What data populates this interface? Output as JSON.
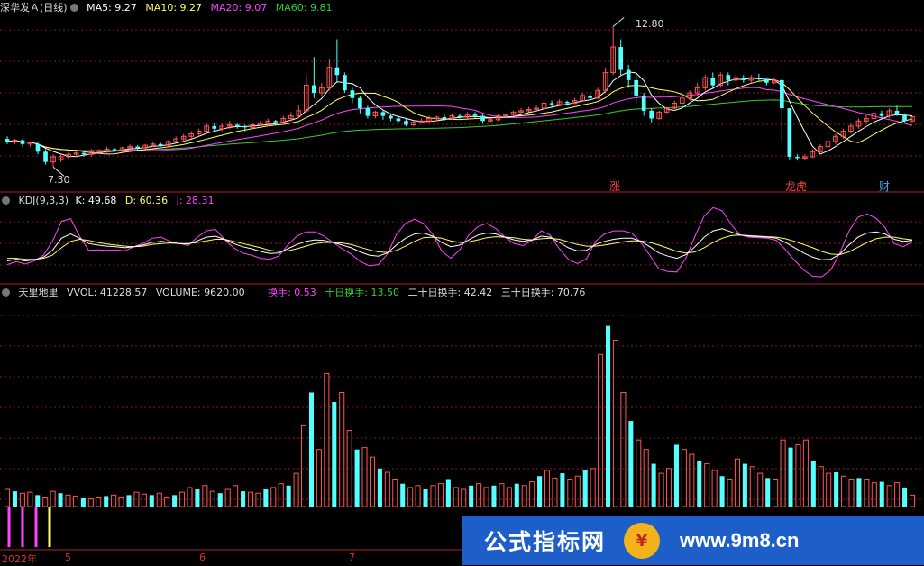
{
  "main": {
    "title": "深华发Ａ(日线)",
    "ma5": "MA5: 9.27",
    "ma10": "MA10: 9.27",
    "ma20": "MA20: 9.07",
    "ma60": "MA60: 9.81",
    "high_label": "12.80",
    "low_label": "7.30",
    "markers": [
      "涨",
      "龙虎",
      "财"
    ]
  },
  "kdj": {
    "name": "KDJ(9,3,3)",
    "k": "K: 49.68",
    "d": "D: 60.36",
    "j": "J: 28.31"
  },
  "vol": {
    "name": "天里地里",
    "vvol": "VVOL: 41228.57",
    "volume": "VOLUME: 9620.00",
    "turnover": "换手: 0.53",
    "turnover10": "十日换手: 13.50",
    "turnover20": "二十日换手: 42.42",
    "turnover30": "三十日换手: 70.76"
  },
  "axis": {
    "labels": [
      "2022年",
      "5",
      "6",
      "7"
    ]
  },
  "watermark": {
    "cn": "公式指标网",
    "url": "www.9m8.cn"
  },
  "colors": {
    "up": "#ff5555",
    "down": "#54ffff",
    "ma5": "#ffffff",
    "ma10": "#ffff66",
    "ma20": "#ff44ff",
    "ma60": "#33cc33",
    "grid": "#8a1a1a"
  },
  "chart_data": {
    "type": "candlestick",
    "price_range": [
      6.5,
      13.2
    ],
    "candles": [
      {
        "o": 8.4,
        "c": 8.3,
        "h": 8.5,
        "l": 8.2
      },
      {
        "o": 8.3,
        "c": 8.35,
        "h": 8.4,
        "l": 8.2
      },
      {
        "o": 8.35,
        "c": 8.2,
        "h": 8.4,
        "l": 8.1
      },
      {
        "o": 8.2,
        "c": 8.25,
        "h": 8.3,
        "l": 8.1
      },
      {
        "o": 8.2,
        "c": 7.9,
        "h": 8.3,
        "l": 7.8
      },
      {
        "o": 7.9,
        "c": 7.5,
        "h": 8.0,
        "l": 7.4
      },
      {
        "o": 7.5,
        "c": 7.7,
        "h": 7.8,
        "l": 7.3
      },
      {
        "o": 7.6,
        "c": 7.7,
        "h": 7.8,
        "l": 7.5
      },
      {
        "o": 7.7,
        "c": 7.8,
        "h": 7.9,
        "l": 7.6
      },
      {
        "o": 7.8,
        "c": 7.85,
        "h": 7.9,
        "l": 7.7
      },
      {
        "o": 7.85,
        "c": 7.8,
        "h": 7.95,
        "l": 7.7
      },
      {
        "o": 7.8,
        "c": 7.9,
        "h": 8.0,
        "l": 7.7
      },
      {
        "o": 7.9,
        "c": 7.95,
        "h": 8.0,
        "l": 7.8
      },
      {
        "o": 7.95,
        "c": 8.0,
        "h": 8.1,
        "l": 7.85
      },
      {
        "o": 8.0,
        "c": 7.95,
        "h": 8.05,
        "l": 7.9
      },
      {
        "o": 7.95,
        "c": 8.05,
        "h": 8.1,
        "l": 7.9
      },
      {
        "o": 8.05,
        "c": 8.1,
        "h": 8.2,
        "l": 8.0
      },
      {
        "o": 8.1,
        "c": 8.05,
        "h": 8.15,
        "l": 7.95
      },
      {
        "o": 8.05,
        "c": 8.15,
        "h": 8.2,
        "l": 8.0
      },
      {
        "o": 8.15,
        "c": 8.2,
        "h": 8.3,
        "l": 8.1
      },
      {
        "o": 8.2,
        "c": 8.15,
        "h": 8.25,
        "l": 8.1
      },
      {
        "o": 8.15,
        "c": 8.3,
        "h": 8.35,
        "l": 8.1
      },
      {
        "o": 8.3,
        "c": 8.4,
        "h": 8.5,
        "l": 8.25
      },
      {
        "o": 8.4,
        "c": 8.5,
        "h": 8.6,
        "l": 8.3
      },
      {
        "o": 8.5,
        "c": 8.6,
        "h": 8.7,
        "l": 8.4
      },
      {
        "o": 8.6,
        "c": 8.7,
        "h": 8.8,
        "l": 8.5
      },
      {
        "o": 8.7,
        "c": 8.9,
        "h": 9.0,
        "l": 8.6
      },
      {
        "o": 8.9,
        "c": 8.8,
        "h": 9.0,
        "l": 8.7
      },
      {
        "o": 8.8,
        "c": 8.9,
        "h": 9.0,
        "l": 8.7
      },
      {
        "o": 8.9,
        "c": 8.95,
        "h": 9.1,
        "l": 8.8
      },
      {
        "o": 8.95,
        "c": 8.9,
        "h": 9.0,
        "l": 8.8
      },
      {
        "o": 8.9,
        "c": 8.85,
        "h": 8.95,
        "l": 8.7
      },
      {
        "o": 8.85,
        "c": 8.95,
        "h": 9.0,
        "l": 8.8
      },
      {
        "o": 8.95,
        "c": 9.0,
        "h": 9.1,
        "l": 8.9
      },
      {
        "o": 9.0,
        "c": 9.1,
        "h": 9.2,
        "l": 8.9
      },
      {
        "o": 9.1,
        "c": 9.05,
        "h": 9.15,
        "l": 8.95
      },
      {
        "o": 9.05,
        "c": 9.2,
        "h": 9.3,
        "l": 9.0
      },
      {
        "o": 9.2,
        "c": 9.3,
        "h": 9.45,
        "l": 9.1
      },
      {
        "o": 9.3,
        "c": 9.5,
        "h": 9.7,
        "l": 9.2
      },
      {
        "o": 9.5,
        "c": 10.5,
        "h": 10.9,
        "l": 9.4
      },
      {
        "o": 10.5,
        "c": 10.2,
        "h": 11.6,
        "l": 10.0
      },
      {
        "o": 10.2,
        "c": 10.4,
        "h": 10.6,
        "l": 10.1
      },
      {
        "o": 10.4,
        "c": 11.2,
        "h": 11.5,
        "l": 10.3
      },
      {
        "o": 11.2,
        "c": 10.9,
        "h": 12.3,
        "l": 10.6
      },
      {
        "o": 10.9,
        "c": 10.3,
        "h": 11.0,
        "l": 10.2
      },
      {
        "o": 10.3,
        "c": 10.0,
        "h": 10.4,
        "l": 9.8
      },
      {
        "o": 10.0,
        "c": 9.6,
        "h": 10.1,
        "l": 9.4
      },
      {
        "o": 9.6,
        "c": 9.3,
        "h": 9.7,
        "l": 9.2
      },
      {
        "o": 9.3,
        "c": 9.45,
        "h": 9.5,
        "l": 9.2
      },
      {
        "o": 9.45,
        "c": 9.3,
        "h": 9.5,
        "l": 9.15
      },
      {
        "o": 9.3,
        "c": 9.2,
        "h": 9.4,
        "l": 9.1
      },
      {
        "o": 9.2,
        "c": 9.1,
        "h": 9.3,
        "l": 9.0
      },
      {
        "o": 9.1,
        "c": 8.95,
        "h": 9.2,
        "l": 8.9
      },
      {
        "o": 8.95,
        "c": 9.05,
        "h": 9.1,
        "l": 8.9
      },
      {
        "o": 9.05,
        "c": 9.1,
        "h": 9.2,
        "l": 9.0
      },
      {
        "o": 9.1,
        "c": 9.2,
        "h": 9.3,
        "l": 9.05
      },
      {
        "o": 9.2,
        "c": 9.25,
        "h": 9.3,
        "l": 9.1
      },
      {
        "o": 9.25,
        "c": 9.2,
        "h": 9.35,
        "l": 9.1
      },
      {
        "o": 9.2,
        "c": 9.3,
        "h": 9.4,
        "l": 9.15
      },
      {
        "o": 9.3,
        "c": 9.25,
        "h": 9.4,
        "l": 9.2
      },
      {
        "o": 9.25,
        "c": 9.35,
        "h": 9.45,
        "l": 9.2
      },
      {
        "o": 9.35,
        "c": 9.3,
        "h": 9.45,
        "l": 9.2
      },
      {
        "o": 9.3,
        "c": 9.1,
        "h": 9.35,
        "l": 9.0
      },
      {
        "o": 9.1,
        "c": 9.15,
        "h": 9.2,
        "l": 9.05
      },
      {
        "o": 9.15,
        "c": 9.3,
        "h": 9.35,
        "l": 9.1
      },
      {
        "o": 9.3,
        "c": 9.35,
        "h": 9.4,
        "l": 9.25
      },
      {
        "o": 9.35,
        "c": 9.45,
        "h": 9.5,
        "l": 9.3
      },
      {
        "o": 9.45,
        "c": 9.5,
        "h": 9.6,
        "l": 9.4
      },
      {
        "o": 9.5,
        "c": 9.55,
        "h": 9.65,
        "l": 9.45
      },
      {
        "o": 9.55,
        "c": 9.6,
        "h": 9.7,
        "l": 9.5
      },
      {
        "o": 9.6,
        "c": 9.8,
        "h": 9.9,
        "l": 9.55
      },
      {
        "o": 9.8,
        "c": 9.75,
        "h": 9.9,
        "l": 9.65
      },
      {
        "o": 9.75,
        "c": 9.85,
        "h": 9.95,
        "l": 9.7
      },
      {
        "o": 9.85,
        "c": 9.8,
        "h": 9.9,
        "l": 9.7
      },
      {
        "o": 9.8,
        "c": 9.9,
        "h": 10.0,
        "l": 9.75
      },
      {
        "o": 9.9,
        "c": 10.1,
        "h": 10.2,
        "l": 9.85
      },
      {
        "o": 10.1,
        "c": 10.0,
        "h": 10.2,
        "l": 9.9
      },
      {
        "o": 10.0,
        "c": 10.3,
        "h": 10.4,
        "l": 9.95
      },
      {
        "o": 10.3,
        "c": 11.0,
        "h": 11.2,
        "l": 10.2
      },
      {
        "o": 11.0,
        "c": 12.0,
        "h": 12.8,
        "l": 10.9
      },
      {
        "o": 12.0,
        "c": 11.1,
        "h": 12.3,
        "l": 10.9
      },
      {
        "o": 11.1,
        "c": 10.7,
        "h": 11.3,
        "l": 10.4
      },
      {
        "o": 10.7,
        "c": 10.1,
        "h": 10.9,
        "l": 9.8
      },
      {
        "o": 10.1,
        "c": 9.5,
        "h": 10.2,
        "l": 9.3
      },
      {
        "o": 9.5,
        "c": 9.2,
        "h": 9.6,
        "l": 9.05
      },
      {
        "o": 9.2,
        "c": 9.45,
        "h": 9.5,
        "l": 9.15
      },
      {
        "o": 9.45,
        "c": 9.6,
        "h": 9.65,
        "l": 9.4
      },
      {
        "o": 9.6,
        "c": 9.8,
        "h": 9.9,
        "l": 9.5
      },
      {
        "o": 9.8,
        "c": 10.0,
        "h": 10.1,
        "l": 9.7
      },
      {
        "o": 10.0,
        "c": 10.2,
        "h": 10.3,
        "l": 9.9
      },
      {
        "o": 10.2,
        "c": 10.4,
        "h": 10.6,
        "l": 10.1
      },
      {
        "o": 10.4,
        "c": 10.8,
        "h": 10.9,
        "l": 10.3
      },
      {
        "o": 10.8,
        "c": 10.5,
        "h": 11.0,
        "l": 10.4
      },
      {
        "o": 10.5,
        "c": 10.9,
        "h": 11.0,
        "l": 10.4
      },
      {
        "o": 10.9,
        "c": 10.7,
        "h": 11.0,
        "l": 10.5
      },
      {
        "o": 10.7,
        "c": 10.8,
        "h": 10.9,
        "l": 10.6
      },
      {
        "o": 10.8,
        "c": 10.7,
        "h": 10.9,
        "l": 10.6
      },
      {
        "o": 10.7,
        "c": 10.8,
        "h": 10.9,
        "l": 10.6
      },
      {
        "o": 10.8,
        "c": 10.75,
        "h": 10.95,
        "l": 10.65
      },
      {
        "o": 10.75,
        "c": 10.6,
        "h": 10.8,
        "l": 10.5
      },
      {
        "o": 10.6,
        "c": 10.7,
        "h": 10.8,
        "l": 10.55
      },
      {
        "o": 10.7,
        "c": 9.6,
        "h": 10.8,
        "l": 8.3
      },
      {
        "o": 9.6,
        "c": 7.7,
        "h": 9.6,
        "l": 7.6
      },
      {
        "o": 7.7,
        "c": 7.65,
        "h": 7.8,
        "l": 7.55
      },
      {
        "o": 7.65,
        "c": 7.7,
        "h": 7.8,
        "l": 7.6
      },
      {
        "o": 7.7,
        "c": 7.9,
        "h": 8.0,
        "l": 7.65
      },
      {
        "o": 7.9,
        "c": 8.1,
        "h": 8.2,
        "l": 7.85
      },
      {
        "o": 8.1,
        "c": 8.3,
        "h": 8.4,
        "l": 8.0
      },
      {
        "o": 8.3,
        "c": 8.5,
        "h": 8.6,
        "l": 8.2
      },
      {
        "o": 8.5,
        "c": 8.7,
        "h": 8.8,
        "l": 8.4
      },
      {
        "o": 8.7,
        "c": 8.9,
        "h": 9.0,
        "l": 8.6
      },
      {
        "o": 8.9,
        "c": 9.1,
        "h": 9.2,
        "l": 8.8
      },
      {
        "o": 9.1,
        "c": 9.2,
        "h": 9.4,
        "l": 9.0
      },
      {
        "o": 9.2,
        "c": 9.4,
        "h": 9.5,
        "l": 9.1
      },
      {
        "o": 9.4,
        "c": 9.3,
        "h": 9.5,
        "l": 9.2
      },
      {
        "o": 9.3,
        "c": 9.5,
        "h": 9.6,
        "l": 9.2
      },
      {
        "o": 9.5,
        "c": 9.35,
        "h": 9.7,
        "l": 9.3
      },
      {
        "o": 9.35,
        "c": 9.1,
        "h": 9.4,
        "l": 9.05
      },
      {
        "o": 9.1,
        "c": 9.27,
        "h": 9.3,
        "l": 9.05
      }
    ],
    "kdj": {
      "k": [
        15,
        18,
        15,
        17,
        22,
        35,
        58,
        66,
        58,
        48,
        45,
        43,
        42,
        40,
        42,
        45,
        50,
        52,
        50,
        48,
        47,
        53,
        60,
        62,
        56,
        48,
        42,
        38,
        33,
        29,
        30,
        38,
        46,
        52,
        55,
        54,
        50,
        45,
        40,
        32,
        26,
        24,
        30,
        45,
        58,
        66,
        68,
        62,
        50,
        42,
        45,
        55,
        64,
        68,
        66,
        60,
        55,
        52,
        55,
        62,
        60,
        50,
        40,
        34,
        35,
        46,
        52,
        56,
        58,
        58,
        52,
        42,
        30,
        24,
        20,
        27,
        42,
        60,
        72,
        76,
        70,
        64,
        62,
        61,
        60,
        58,
        50,
        40,
        30,
        22,
        17,
        18,
        28,
        45,
        60,
        68,
        70,
        66,
        56,
        52,
        54
      ],
      "d": [
        20,
        20,
        18,
        18,
        20,
        26,
        40,
        52,
        56,
        54,
        50,
        47,
        45,
        43,
        42,
        43,
        46,
        48,
        49,
        48,
        48,
        50,
        53,
        56,
        56,
        52,
        48,
        44,
        40,
        35,
        33,
        34,
        38,
        43,
        48,
        50,
        50,
        49,
        46,
        41,
        36,
        32,
        31,
        35,
        43,
        52,
        59,
        60,
        58,
        53,
        50,
        51,
        55,
        59,
        61,
        60,
        59,
        56,
        55,
        57,
        58,
        56,
        51,
        46,
        43,
        43,
        45,
        48,
        51,
        53,
        53,
        50,
        45,
        39,
        33,
        30,
        32,
        40,
        50,
        58,
        63,
        64,
        63,
        62,
        61,
        60,
        57,
        52,
        46,
        40,
        33,
        28,
        27,
        32,
        41,
        50,
        57,
        60,
        60,
        57,
        55
      ],
      "j": [
        8,
        14,
        9,
        15,
        26,
        52,
        90,
        95,
        62,
        35,
        36,
        35,
        36,
        34,
        42,
        48,
        58,
        60,
        52,
        48,
        44,
        60,
        72,
        75,
        56,
        40,
        30,
        26,
        20,
        18,
        24,
        45,
        62,
        70,
        70,
        62,
        50,
        38,
        28,
        14,
        6,
        8,
        28,
        65,
        86,
        94,
        86,
        66,
        34,
        20,
        36,
        64,
        80,
        86,
        76,
        60,
        48,
        44,
        54,
        72,
        64,
        38,
        18,
        10,
        19,
        52,
        66,
        72,
        72,
        68,
        50,
        26,
        0,
        -5,
        -6,
        21,
        62,
        100,
        116,
        110,
        84,
        64,
        60,
        59,
        58,
        54,
        36,
        16,
        -2,
        -14,
        -15,
        -2,
        30,
        71,
        98,
        104,
        96,
        78,
        48,
        42,
        51
      ]
    },
    "volume": [
      18,
      16,
      14,
      15,
      12,
      10,
      16,
      14,
      12,
      11,
      9,
      8,
      10,
      11,
      12,
      10,
      12,
      15,
      13,
      12,
      14,
      10,
      12,
      15,
      20,
      18,
      22,
      16,
      14,
      18,
      22,
      16,
      15,
      14,
      18,
      20,
      24,
      22,
      35,
      85,
      120,
      60,
      140,
      110,
      120,
      80,
      60,
      62,
      52,
      40,
      36,
      28,
      24,
      20,
      22,
      18,
      22,
      24,
      28,
      20,
      18,
      22,
      24,
      20,
      22,
      24,
      20,
      24,
      22,
      26,
      32,
      38,
      30,
      35,
      28,
      32,
      38,
      40,
      160,
      190,
      175,
      120,
      90,
      70,
      60,
      45,
      35,
      40,
      65,
      60,
      55,
      48,
      45,
      38,
      32,
      28,
      50,
      45,
      42,
      35,
      30,
      28,
      70,
      62,
      65,
      70,
      48,
      42,
      35,
      36,
      32,
      28,
      30,
      28,
      25,
      26,
      22,
      25,
      20,
      12
    ],
    "volume_max": 220
  }
}
